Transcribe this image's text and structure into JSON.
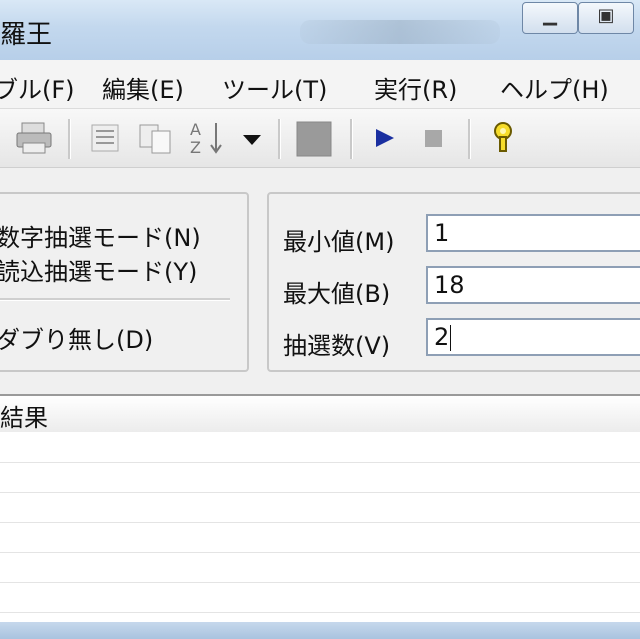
{
  "window": {
    "title": "羅王"
  },
  "menu": [
    {
      "label": "ブル(F)"
    },
    {
      "label": "編集(E)"
    },
    {
      "label": "ツール(T)"
    },
    {
      "label": "実行(R)"
    },
    {
      "label": "ヘルプ(H)"
    }
  ],
  "toolbar": {
    "icons": [
      "print-icon",
      "list-icon",
      "copy-icon",
      "sort-icon",
      "dropdown-arrow-icon",
      "stop-square-icon",
      "play-icon",
      "stop-icon",
      "help-icon"
    ]
  },
  "options": {
    "mode1": "数字抽選モード(N)",
    "mode2": "読込抽選モード(Y)",
    "no_dup": "ダブり無し(D)"
  },
  "fields": {
    "min": {
      "label": "最小値(M)",
      "value": "1"
    },
    "max": {
      "label": "最大値(B)",
      "value": "18"
    },
    "count": {
      "label": "抽選数(V)",
      "value": "2"
    }
  },
  "result": {
    "title": "結果"
  },
  "colors": {
    "play": "#1a2fa0",
    "help": "#e3c300"
  }
}
